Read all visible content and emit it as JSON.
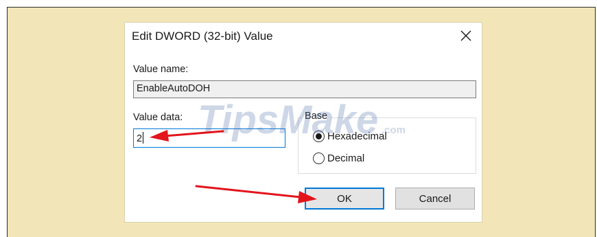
{
  "dialog": {
    "title": "Edit DWORD (32-bit) Value",
    "value_name_label": "Value name:",
    "value_name": "EnableAutoDOH",
    "value_data_label": "Value data:",
    "value_data": "2",
    "base_label": "Base",
    "radio_hex_label": "Hexadecimal",
    "radio_dec_label": "Decimal",
    "selected_base": "Hexadecimal",
    "ok_label": "OK",
    "cancel_label": "Cancel"
  },
  "watermark": {
    "brand": "TipsMake",
    "suffix": ".com"
  },
  "colors": {
    "background": "#f2e6b8",
    "accent": "#0078d7",
    "arrow": "#e3141b",
    "watermark": "#4f6fa8"
  }
}
